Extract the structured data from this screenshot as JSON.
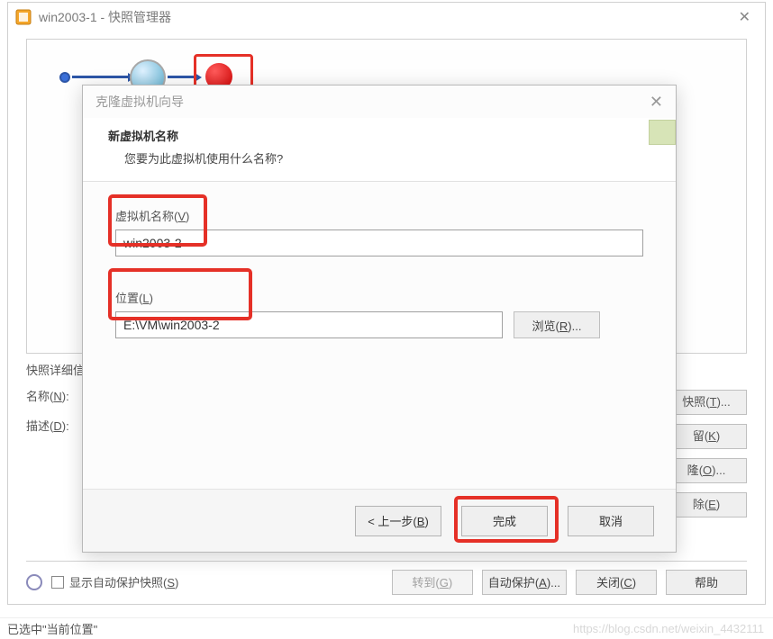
{
  "parent": {
    "title": "win2003-1 - 快照管理器",
    "close_glyph": "✕"
  },
  "details": {
    "section_label": "快照详细信",
    "name_label": "名称",
    "name_hotkey": "N",
    "desc_label": "描述",
    "desc_hotkey": "D"
  },
  "side_buttons": {
    "snap": "快照",
    "snap_hotkey": "T",
    "keep": "留",
    "keep_hotkey": "K",
    "clone": "隆",
    "clone_hotkey": "O",
    "delete": "除",
    "delete_hotkey": "E"
  },
  "bottom": {
    "autoprotect_label": "显示自动保护快照",
    "autoprotect_hotkey": "S",
    "goto": "转到",
    "goto_hotkey": "G",
    "auto": "自动保护",
    "auto_hotkey": "A",
    "close": "关闭",
    "close_hotkey": "C",
    "help": "帮助"
  },
  "wizard": {
    "title": "克隆虚拟机向导",
    "close_glyph": "✕",
    "heading": "新虚拟机名称",
    "subheading": "您要为此虚拟机使用什么名称?",
    "vm_name_label": "虚拟机名称",
    "vm_name_hotkey": "V",
    "vm_name_value": "win2003-2",
    "location_label": "位置",
    "location_hotkey": "L",
    "location_value": "E:\\VM\\win2003-2",
    "browse": "浏览",
    "browse_hotkey": "R",
    "back": "< 上一步",
    "back_hotkey": "B",
    "finish": "完成",
    "cancel": "取消"
  },
  "status": {
    "text": "已选中\"当前位置\""
  },
  "watermark": "https://blog.csdn.net/weixin_4432111"
}
